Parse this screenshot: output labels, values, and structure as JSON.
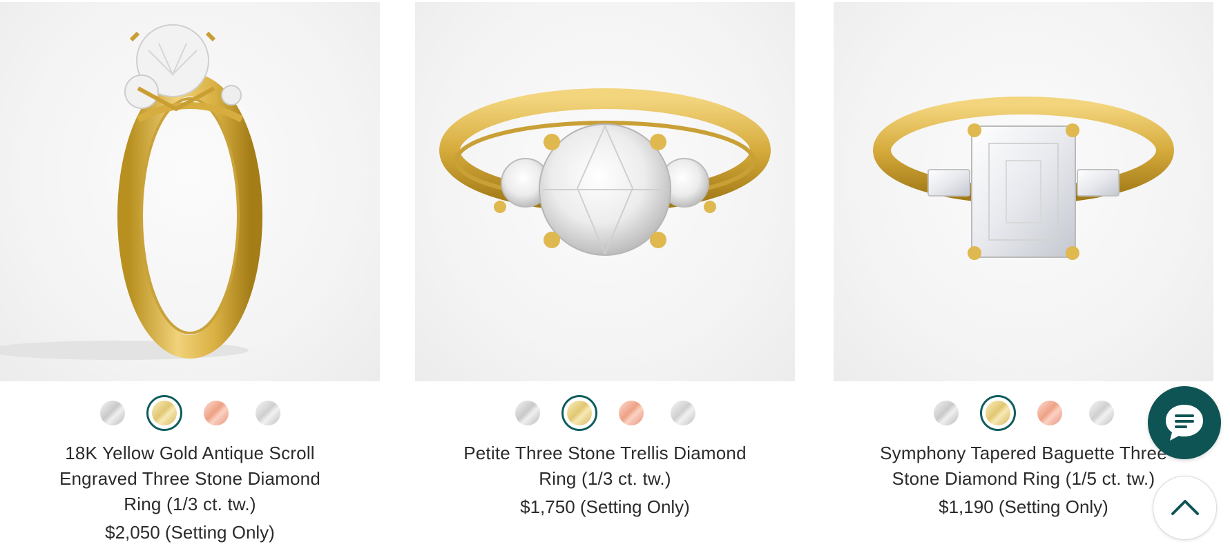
{
  "products": [
    {
      "title": "18K Yellow Gold Antique Scroll Engraved Three Stone Diamond Ring (1/3 ct. tw.)",
      "price": "$2,050 (Setting Only)",
      "metals": [
        "white-gold",
        "yellow-gold",
        "rose-gold",
        "platinum"
      ],
      "selected_metal": "yellow-gold"
    },
    {
      "title": "Petite Three Stone Trellis Diamond Ring (1/3 ct. tw.)",
      "price": "$1,750 (Setting Only)",
      "metals": [
        "white-gold",
        "yellow-gold",
        "rose-gold",
        "platinum"
      ],
      "selected_metal": "yellow-gold"
    },
    {
      "title": "Symphony Tapered Baguette Three Stone Diamond Ring (1/5 ct. tw.)",
      "price": "$1,190 (Setting Only)",
      "metals": [
        "white-gold",
        "yellow-gold",
        "rose-gold",
        "platinum"
      ],
      "selected_metal": "yellow-gold"
    }
  ],
  "colors": {
    "accent": "#0f5454",
    "gold": "#d8b24a",
    "text": "#2b2b2b"
  },
  "icons": {
    "chat": "chat-bubble-icon",
    "back_to_top": "chevron-up-icon"
  }
}
